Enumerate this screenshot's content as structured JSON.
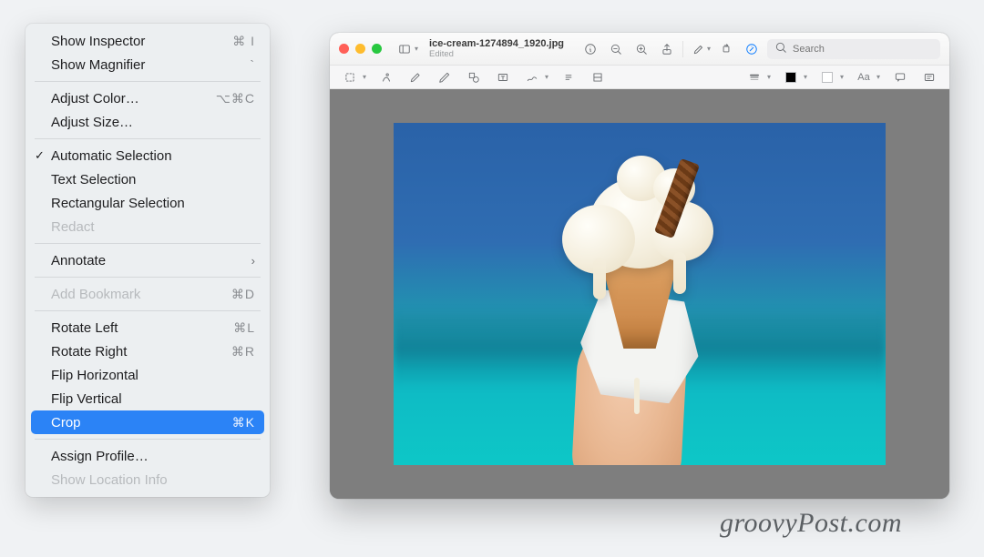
{
  "menu": {
    "items": [
      {
        "label": "Show Inspector",
        "shortcut": "⌘ I",
        "enabled": true
      },
      {
        "label": "Show Magnifier",
        "shortcut": "`",
        "enabled": true
      },
      {
        "sep": true
      },
      {
        "label": "Adjust Color…",
        "shortcut": "⌥⌘C",
        "enabled": true
      },
      {
        "label": "Adjust Size…",
        "shortcut": "",
        "enabled": true
      },
      {
        "sep": true
      },
      {
        "label": "Automatic Selection",
        "shortcut": "",
        "enabled": true,
        "checked": true
      },
      {
        "label": "Text Selection",
        "shortcut": "",
        "enabled": true
      },
      {
        "label": "Rectangular Selection",
        "shortcut": "",
        "enabled": true
      },
      {
        "label": "Redact",
        "shortcut": "",
        "enabled": false
      },
      {
        "sep": true
      },
      {
        "label": "Annotate",
        "shortcut": "",
        "enabled": true,
        "submenu": true
      },
      {
        "sep": true
      },
      {
        "label": "Add Bookmark",
        "shortcut": "⌘D",
        "enabled": false
      },
      {
        "sep": true
      },
      {
        "label": "Rotate Left",
        "shortcut": "⌘L",
        "enabled": true
      },
      {
        "label": "Rotate Right",
        "shortcut": "⌘R",
        "enabled": true
      },
      {
        "label": "Flip Horizontal",
        "shortcut": "",
        "enabled": true
      },
      {
        "label": "Flip Vertical",
        "shortcut": "",
        "enabled": true
      },
      {
        "label": "Crop",
        "shortcut": "⌘K",
        "enabled": true,
        "highlighted": true
      },
      {
        "sep": true
      },
      {
        "label": "Assign Profile…",
        "shortcut": "",
        "enabled": true
      },
      {
        "label": "Show Location Info",
        "shortcut": "",
        "enabled": false
      }
    ]
  },
  "window": {
    "filename": "ice-cream-1274894_1920.jpg",
    "status": "Edited",
    "search_placeholder": "Search",
    "toolbar": {
      "sidebar_icon": "sidebar-icon",
      "info_icon": "info-icon",
      "zoom_out_icon": "zoom-out-icon",
      "zoom_in_icon": "zoom-in-icon",
      "share_icon": "share-icon",
      "highlight_icon": "highlighter-icon",
      "rotate_icon": "rotate-icon",
      "markup_icon": "markup-icon",
      "search_icon": "search-icon"
    },
    "markup_bar": {
      "items": [
        "selection-tool",
        "instant-alpha-tool",
        "lasso-tool",
        "sketch-tool",
        "shapes-tool",
        "text-tool",
        "sign-tool",
        "adjust-color-tool",
        "adjust-size-tool",
        "shape-style",
        "border-color",
        "fill-color",
        "text-style",
        "annotate-tool",
        "description-tool"
      ]
    }
  },
  "image": {
    "subject": "hand holding melting vanilla ice-cream cone with chocolate flake",
    "background": "blurred blue sky and turquoise sea"
  },
  "watermark": "groovyPost.com",
  "colors": {
    "highlight": "#2b83f6",
    "window_bg": "#7e7e7e"
  }
}
